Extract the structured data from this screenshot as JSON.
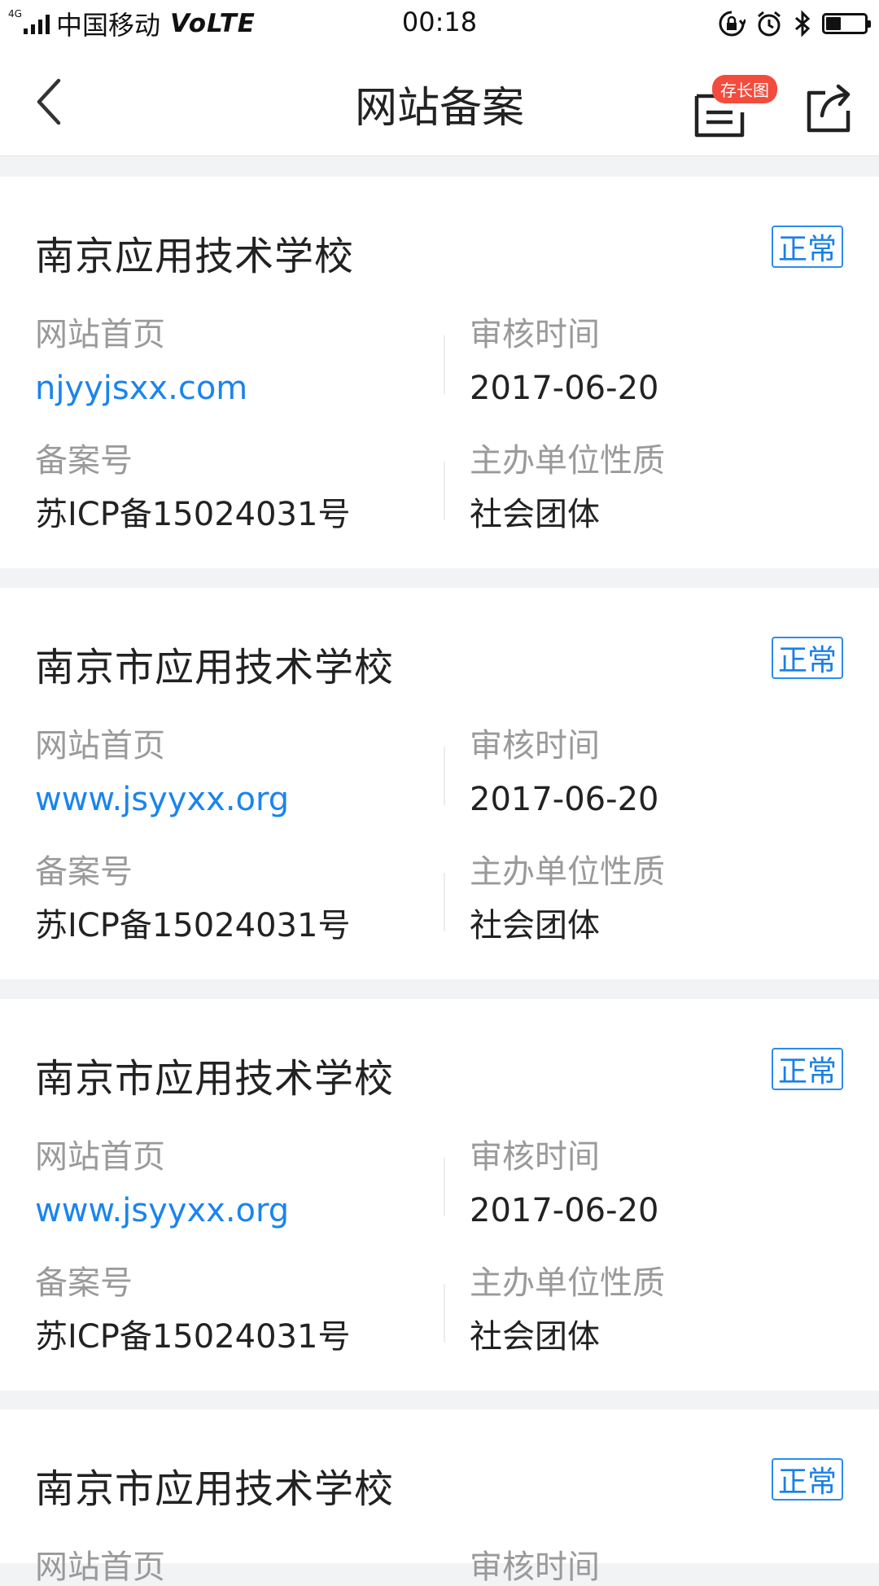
{
  "status_bar": {
    "network": "4G",
    "carrier": "中国移动",
    "volte": "VoLTE",
    "time": "00:18",
    "icons": [
      "rotation-lock-icon",
      "alarm-icon",
      "bluetooth-icon",
      "battery-icon"
    ]
  },
  "header": {
    "title": "网站备案",
    "save_long_badge": "存长图",
    "icons": [
      "back-arrow-icon",
      "save-long-image-icon",
      "share-icon"
    ]
  },
  "labels": {
    "homepage": "网站首页",
    "review_time": "审核时间",
    "record_no": "备案号",
    "organizer_type": "主办单位性质"
  },
  "records": [
    {
      "name": "南京应用技术学校",
      "status": "正常",
      "homepage": "njyyjsxx.com",
      "review_time": "2017-06-20",
      "record_no": "苏ICP备15024031号",
      "organizer_type": "社会团体"
    },
    {
      "name": "南京市应用技术学校",
      "status": "正常",
      "homepage": "www.jsyyxx.org",
      "review_time": "2017-06-20",
      "record_no": "苏ICP备15024031号",
      "organizer_type": "社会团体"
    },
    {
      "name": "南京市应用技术学校",
      "status": "正常",
      "homepage": "www.jsyyxx.org",
      "review_time": "2017-06-20",
      "record_no": "苏ICP备15024031号",
      "organizer_type": "社会团体"
    },
    {
      "name": "南京市应用技术学校",
      "status": "正常",
      "homepage": "",
      "review_time": "",
      "record_no": "",
      "organizer_type": ""
    }
  ],
  "colors": {
    "link": "#1a84ee",
    "badge_border": "#2a8cf0",
    "save_badge": "#f24c3d",
    "page_bg": "#f2f3f5"
  }
}
